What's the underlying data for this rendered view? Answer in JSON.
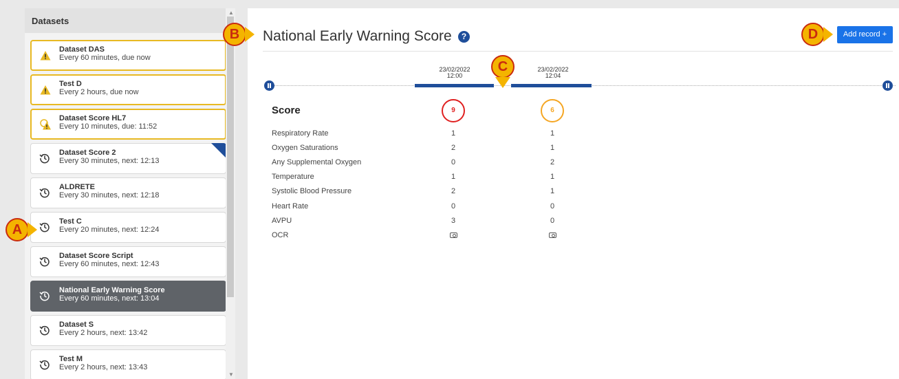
{
  "sidebar": {
    "title": "Datasets",
    "items": [
      {
        "name": "Dataset DAS",
        "sub": "Every 60 minutes, due now",
        "icon": "warning-icon"
      },
      {
        "name": "Test D",
        "sub": "Every 2 hours, due now",
        "icon": "warning-icon"
      },
      {
        "name": "Dataset Score HL7",
        "sub": "Every 10 minutes, due: 11:52",
        "icon": "clock-warning-icon"
      },
      {
        "name": "Dataset Score 2",
        "sub": "Every 30 minutes, next: 12:13",
        "icon": "history-icon"
      },
      {
        "name": "ALDRETE",
        "sub": "Every 30 minutes, next: 12:18",
        "icon": "history-icon"
      },
      {
        "name": "Test C",
        "sub": "Every 20 minutes, next: 12:24",
        "icon": "history-icon"
      },
      {
        "name": "Dataset Score Script",
        "sub": "Every 60 minutes, next: 12:43",
        "icon": "history-icon"
      },
      {
        "name": "National Early Warning Score",
        "sub": "Every 60 minutes, next: 13:04",
        "icon": "history-icon"
      },
      {
        "name": "Dataset S",
        "sub": "Every 2 hours, next: 13:42",
        "icon": "history-icon"
      },
      {
        "name": "Test M",
        "sub": "Every 2 hours, next: 13:43",
        "icon": "history-icon"
      }
    ]
  },
  "main": {
    "title": "National Early Warning Score",
    "help_icon": "?",
    "add_button": "Add record +",
    "timeline": {
      "records": [
        {
          "date": "23/02/2022",
          "time": "12:00"
        },
        {
          "date": "23/02/2022",
          "time": "12:04"
        }
      ]
    },
    "score_label": "Score",
    "scores": [
      "9",
      "6"
    ],
    "rows": [
      {
        "label": "Respiratory Rate",
        "values": [
          "1",
          "1"
        ]
      },
      {
        "label": "Oxygen Saturations",
        "values": [
          "2",
          "1"
        ]
      },
      {
        "label": "Any Supplemental Oxygen",
        "values": [
          "0",
          "2"
        ]
      },
      {
        "label": "Temperature",
        "values": [
          "1",
          "1"
        ]
      },
      {
        "label": "Systolic Blood Pressure",
        "values": [
          "2",
          "1"
        ]
      },
      {
        "label": "Heart Rate",
        "values": [
          "0",
          "0"
        ]
      },
      {
        "label": "AVPU",
        "values": [
          "3",
          "0"
        ]
      }
    ],
    "ocr_label": "OCR"
  },
  "callouts": {
    "a": "A",
    "b": "B",
    "c": "C",
    "d": "D"
  },
  "colors": {
    "accent": "#1f4e9a",
    "button": "#1a73e8",
    "warning": "#e8b923",
    "score_high": "#e02020",
    "score_medium": "#f5a623",
    "active_item": "#5f6368"
  }
}
